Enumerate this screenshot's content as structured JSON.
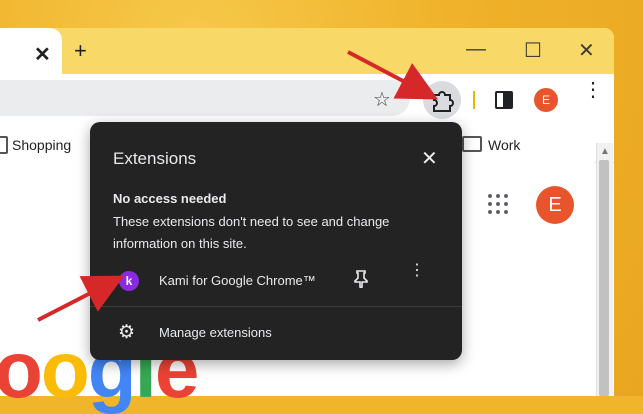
{
  "browser": {
    "tab_close_symbol": "✕",
    "new_tab_symbol": "+",
    "window_minimize": "—",
    "window_maximize": "☐",
    "window_close": "✕",
    "profile_initial": "E"
  },
  "bookmarks": {
    "items": [
      {
        "label": "Shopping"
      },
      {
        "label": "Work"
      }
    ]
  },
  "page": {
    "profile_initial": "E",
    "google_partial": "oogle"
  },
  "popup": {
    "title": "Extensions",
    "section_title": "No access needed",
    "section_desc": "These extensions don't need to see and change information on this site.",
    "extension": {
      "name": "Kami for Google Chrome™",
      "icon_letter": "k",
      "icon_color": "#8a2be2"
    },
    "manage_label": "Manage extensions"
  },
  "colors": {
    "accent_arrow": "#d62828",
    "avatar": "#e8552d",
    "popup_bg": "#232323"
  }
}
